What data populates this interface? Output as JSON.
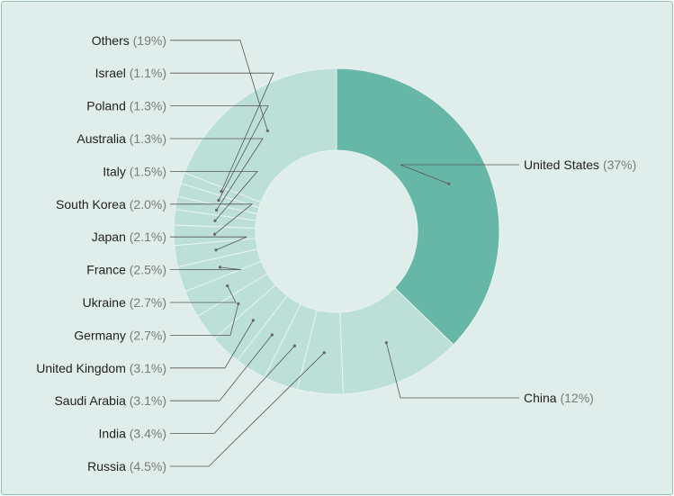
{
  "chart_data": {
    "type": "pie",
    "donut": true,
    "title": "",
    "colors": {
      "highlight": "#66b7a6",
      "other": "#bce0d8",
      "separator": "#e8f3f0",
      "leader": "#555555",
      "background": "#e0eeeb",
      "border": "#8fc2b5"
    },
    "slices": [
      {
        "label": "United States",
        "pct_label": "(37%)",
        "value": 37
      },
      {
        "label": "China",
        "pct_label": "(12%)",
        "value": 12
      },
      {
        "label": "Russia",
        "pct_label": "(4.5%)",
        "value": 4.5
      },
      {
        "label": "India",
        "pct_label": "(3.4%)",
        "value": 3.4
      },
      {
        "label": "Saudi Arabia",
        "pct_label": "(3.1%)",
        "value": 3.1
      },
      {
        "label": "United Kingdom",
        "pct_label": "(3.1%)",
        "value": 3.1
      },
      {
        "label": "Germany",
        "pct_label": "(2.7%)",
        "value": 2.7
      },
      {
        "label": "Ukraine",
        "pct_label": "(2.7%)",
        "value": 2.7
      },
      {
        "label": "France",
        "pct_label": "(2.5%)",
        "value": 2.5
      },
      {
        "label": "Japan",
        "pct_label": "(2.1%)",
        "value": 2.1
      },
      {
        "label": "South Korea",
        "pct_label": "(2.0%)",
        "value": 2.0
      },
      {
        "label": "Italy",
        "pct_label": "(1.5%)",
        "value": 1.5
      },
      {
        "label": "Australia",
        "pct_label": "(1.3%)",
        "value": 1.3
      },
      {
        "label": "Poland",
        "pct_label": "(1.3%)",
        "value": 1.3
      },
      {
        "label": "Israel",
        "pct_label": "(1.1%)",
        "value": 1.1
      },
      {
        "label": "Others",
        "pct_label": "(19%)",
        "value": 19
      }
    ]
  }
}
